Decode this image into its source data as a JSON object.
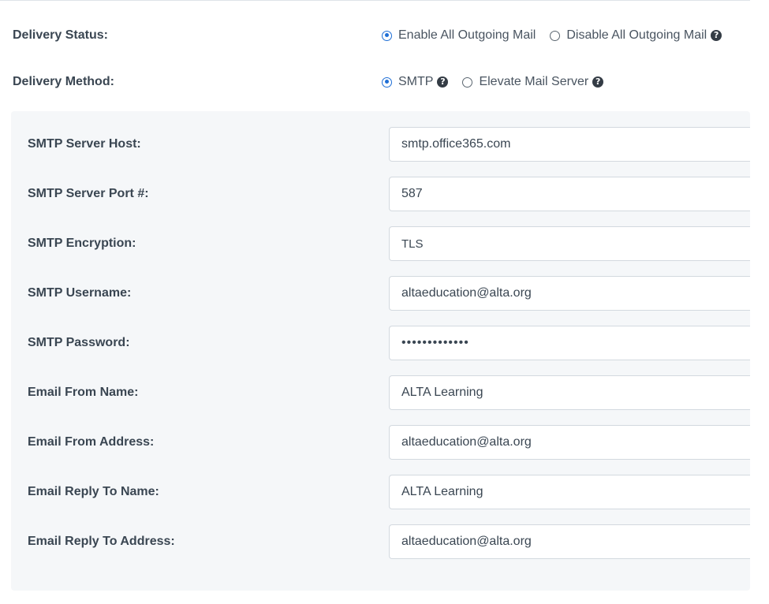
{
  "delivery_status": {
    "label": "Delivery Status:",
    "options": [
      {
        "label": "Enable All Outgoing Mail",
        "checked": true
      },
      {
        "label": "Disable All Outgoing Mail",
        "checked": false
      }
    ]
  },
  "delivery_method": {
    "label": "Delivery Method:",
    "options": [
      {
        "label": "SMTP",
        "checked": true
      },
      {
        "label": "Elevate Mail Server",
        "checked": false
      }
    ]
  },
  "help_glyph": "?",
  "smtp": {
    "host": {
      "label": "SMTP Server Host:",
      "value": "smtp.office365.com"
    },
    "port": {
      "label": "SMTP Server Port #:",
      "value": "587"
    },
    "encryption": {
      "label": "SMTP Encryption:",
      "value": "TLS"
    },
    "username": {
      "label": "SMTP Username:",
      "value": "altaeducation@alta.org"
    },
    "password": {
      "label": "SMTP Password:",
      "value": "•••••••••••••"
    },
    "from_name": {
      "label": "Email From Name:",
      "value": "ALTA Learning"
    },
    "from_address": {
      "label": "Email From Address:",
      "value": "altaeducation@alta.org"
    },
    "reply_name": {
      "label": "Email Reply To Name:",
      "value": "ALTA Learning"
    },
    "reply_address": {
      "label": "Email Reply To Address:",
      "value": "altaeducation@alta.org"
    }
  },
  "colors": {
    "accent": "#1f6fd6",
    "panel_bg": "#f5f7f9",
    "label_text": "#3a4652"
  }
}
